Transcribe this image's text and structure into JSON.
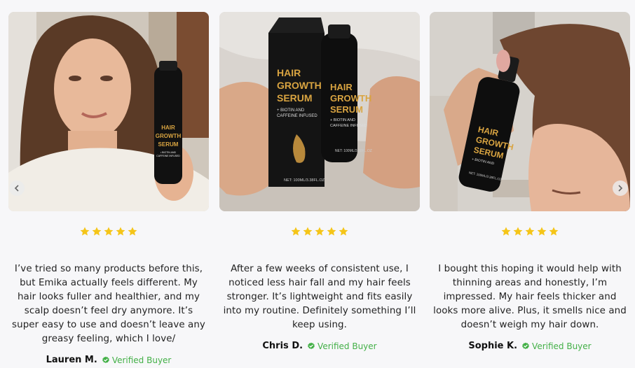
{
  "reviews": [
    {
      "rating": 5,
      "text": "I’ve tried so many products before this, but Emika actually feels different. My hair looks fuller and healthier, and my scalp doesn’t feel dry anymore. It’s super easy to use and doesn’t leave any greasy feeling, which I love/",
      "author": "Lauren M.",
      "badge": "Verified Buyer",
      "bottle_text": [
        "HAIR",
        "GROWTH",
        "SERUM",
        "• BIOTIN AND",
        "CAFFEINE INFUSED"
      ]
    },
    {
      "rating": 5,
      "text": "After a few weeks of consistent use, I noticed less hair fall and my hair feels stronger. It’s lightweight and fits easily into my routine. Definitely something I’ll keep using.",
      "author": "Chris D.",
      "badge": "Verified Buyer",
      "box_text": [
        "HAIR",
        "GROWTH",
        "SERUM",
        "+ BIOTIN AND",
        "CAFFEINE INFUSED",
        "NET: 100ML/3.38FL.OZ"
      ],
      "bottle_text": [
        "HAIR",
        "GROWTH",
        "SERUM",
        "+ BIOTIN AND",
        "CAFFEINE INFUSED",
        "NET: 100ML/3.38FL.OZ"
      ]
    },
    {
      "rating": 5,
      "text": "I bought this hoping it would help with thinning areas and honestly, I’m impressed. My hair feels thicker and looks more alive. Plus, it smells nice and doesn’t weigh my hair down.",
      "author": "Sophie K.",
      "badge": "Verified Buyer",
      "bottle_text": [
        "HAIR",
        "GROWTH",
        "SERUM",
        "+ BIOTIN AND",
        "NET: 100ML/3.38FL.OZ"
      ]
    }
  ],
  "colors": {
    "star": "#f5c518",
    "verified": "#43b047",
    "bottle": "#111111",
    "bottle_label": "#d9a441"
  },
  "icons": {
    "prev": "chevron-left-icon",
    "next": "chevron-right-icon",
    "badge": "check-circle-icon",
    "star": "star-icon"
  }
}
